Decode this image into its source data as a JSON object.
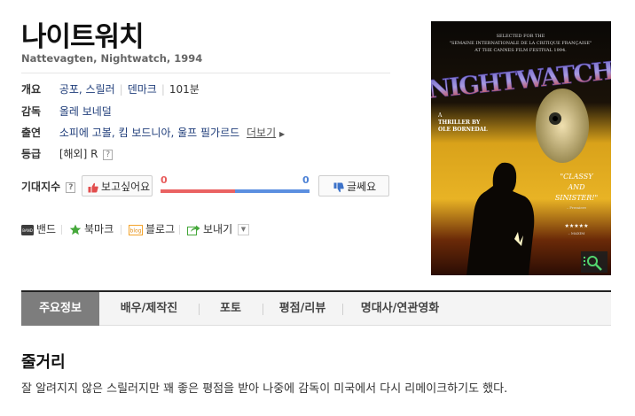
{
  "movie": {
    "title": "나이트워치",
    "subtitle": "Nattevagten, Nightwatch, 1994"
  },
  "info": {
    "overview": {
      "label": "개요",
      "genre": "공포, 스릴러",
      "country": "덴마크",
      "runtime": "101분"
    },
    "director": {
      "label": "감독",
      "value": "올레 보네덜"
    },
    "cast": {
      "label": "출연",
      "value": "소피에 고볼, 킴 보드니아, 울프 필가르드",
      "more": "더보기"
    },
    "rating": {
      "label": "등급",
      "value": "[해외] R"
    }
  },
  "expectation": {
    "label": "기대지수",
    "want_label": "보고싶어요",
    "dislike_label": "글쎄요",
    "want_count": "0",
    "dislike_count": "0",
    "help_icon": "?"
  },
  "share": {
    "band": "밴드",
    "bookmark": "북마크",
    "blog": "블로그",
    "send": "보내기",
    "band_icon_text": "BAND",
    "blog_icon_text": "blog"
  },
  "poster": {
    "top_text_1": "SELECTED FOR THE",
    "top_text_2": "\"SEMAINE INTERNATIONALE DE LA CRITIQUE FRANÇAISE\"",
    "top_text_3": "AT THE CANNES FILM FESTIVAL 1994.",
    "logo": "NIGHTWATCH",
    "thriller_1": "A",
    "thriller_2": "THRILLER BY",
    "thriller_3": "OLE BORNEDAL",
    "quote_1": "\"CLASSY",
    "quote_2": "AND",
    "quote_3": "SINISTER!\"",
    "quote_source": "– Premiere",
    "stars": "★★★★★",
    "stars_source": "– MAXIM"
  },
  "tabs": [
    "주요정보",
    "배우/제작진",
    "포토",
    "평점/리뷰",
    "명대사/연관영화"
  ],
  "synopsis": {
    "heading": "줄거리",
    "text": "잘 알려지지 않은 스릴러지만 꽤 좋은 평점을 받아 나중에 감독이 미국에서 다시 리메이크하기도 했다."
  },
  "colors": {
    "want": "#e85c5c",
    "dislike": "#4d82d6",
    "link": "#1f3d7a",
    "tab_active": "#7d7d7d"
  }
}
